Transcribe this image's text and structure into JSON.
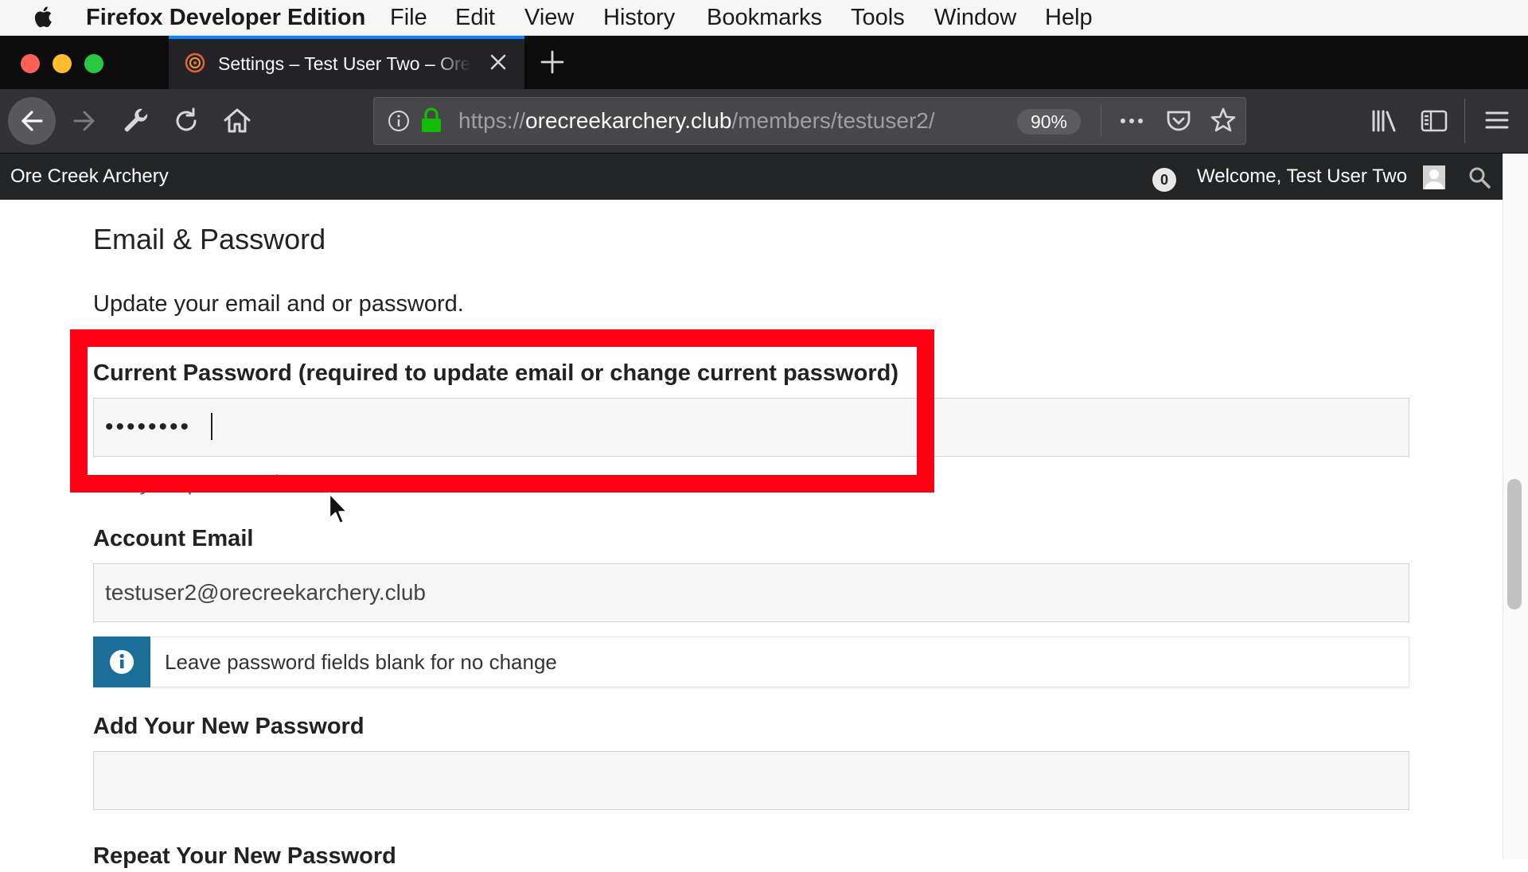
{
  "menubar": {
    "app_name": "Firefox Developer Edition",
    "items": [
      "File",
      "Edit",
      "View",
      "History",
      "Bookmarks",
      "Tools",
      "Window",
      "Help"
    ]
  },
  "tab": {
    "title": "Settings – Test User Two – Ore Creek Archery"
  },
  "toolbar": {
    "url_prefix": "https://",
    "url_domain": "orecreekarchery.club",
    "url_path": "/members/testuser2/",
    "zoom": "90%"
  },
  "site": {
    "name": "Ore Creek Archery",
    "notification_count": "0",
    "welcome": "Welcome, Test User Two"
  },
  "settings": {
    "heading": "Email & Password",
    "description": "Update your email and or password.",
    "current_password_label": "Current Password (required to update email or change current password)",
    "current_password_value": "••••••••",
    "forgot_link": "Lost your password?",
    "account_email_label": "Account Email",
    "account_email_value": "testuser2@orecreekarchery.club",
    "notice": "Leave password fields blank for no change",
    "new_password_label": "Add Your New Password",
    "new_password_value": "",
    "repeat_password_label": "Repeat Your New Password"
  },
  "colors": {
    "highlight": "#ff0012",
    "info_accent": "#1a6e98",
    "site_header": "#222426",
    "tab_accent": "#0a84ff"
  },
  "icons": [
    "apple-icon",
    "firefox-dev-icon",
    "close-tab-icon",
    "new-tab-icon",
    "back-icon",
    "forward-icon",
    "wrench-icon",
    "reload-icon",
    "home-icon",
    "info-icon",
    "lock-icon",
    "more-icon",
    "pocket-icon",
    "star-icon",
    "library-icon",
    "sidebar-icon",
    "hamburger-menu-icon",
    "user-avatar-icon",
    "search-icon",
    "info-circle-icon",
    "mouse-cursor-icon"
  ]
}
